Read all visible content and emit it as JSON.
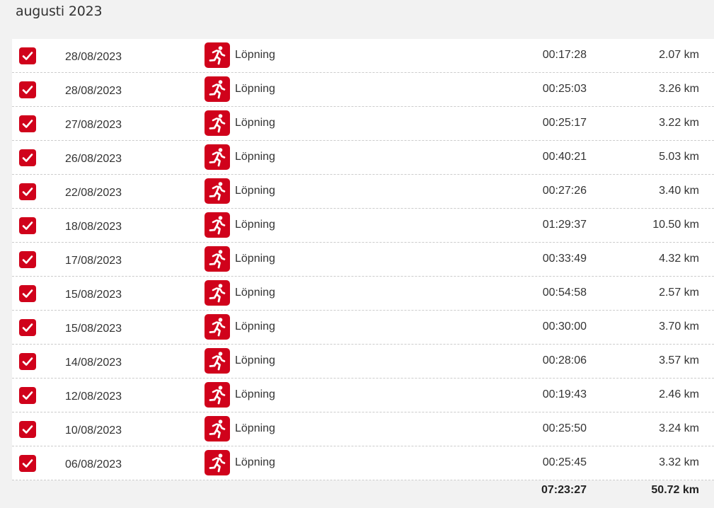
{
  "month_title": "augusti 2023",
  "colors": {
    "accent": "#d0021b",
    "background": "#f2f2f2",
    "row_background": "#ffffff",
    "divider": "#cccccc"
  },
  "rows": [
    {
      "checked": true,
      "date": "28/08/2023",
      "icon": "running-person-icon",
      "activity": "Löpning",
      "duration": "00:17:28",
      "distance": "2.07 km"
    },
    {
      "checked": true,
      "date": "28/08/2023",
      "icon": "running-person-icon",
      "activity": "Löpning",
      "duration": "00:25:03",
      "distance": "3.26 km"
    },
    {
      "checked": true,
      "date": "27/08/2023",
      "icon": "running-person-icon",
      "activity": "Löpning",
      "duration": "00:25:17",
      "distance": "3.22 km"
    },
    {
      "checked": true,
      "date": "26/08/2023",
      "icon": "running-person-icon",
      "activity": "Löpning",
      "duration": "00:40:21",
      "distance": "5.03 km"
    },
    {
      "checked": true,
      "date": "22/08/2023",
      "icon": "running-person-icon",
      "activity": "Löpning",
      "duration": "00:27:26",
      "distance": "3.40 km"
    },
    {
      "checked": true,
      "date": "18/08/2023",
      "icon": "running-person-icon",
      "activity": "Löpning",
      "duration": "01:29:37",
      "distance": "10.50 km"
    },
    {
      "checked": true,
      "date": "17/08/2023",
      "icon": "running-person-icon",
      "activity": "Löpning",
      "duration": "00:33:49",
      "distance": "4.32 km"
    },
    {
      "checked": true,
      "date": "15/08/2023",
      "icon": "running-person-icon",
      "activity": "Löpning",
      "duration": "00:54:58",
      "distance": "2.57 km"
    },
    {
      "checked": true,
      "date": "15/08/2023",
      "icon": "running-person-icon",
      "activity": "Löpning",
      "duration": "00:30:00",
      "distance": "3.70 km"
    },
    {
      "checked": true,
      "date": "14/08/2023",
      "icon": "running-person-icon",
      "activity": "Löpning",
      "duration": "00:28:06",
      "distance": "3.57 km"
    },
    {
      "checked": true,
      "date": "12/08/2023",
      "icon": "running-person-icon",
      "activity": "Löpning",
      "duration": "00:19:43",
      "distance": "2.46 km"
    },
    {
      "checked": true,
      "date": "10/08/2023",
      "icon": "running-person-icon",
      "activity": "Löpning",
      "duration": "00:25:50",
      "distance": "3.24 km"
    },
    {
      "checked": true,
      "date": "06/08/2023",
      "icon": "running-person-icon",
      "activity": "Löpning",
      "duration": "00:25:45",
      "distance": "3.32 km"
    }
  ],
  "totals": {
    "duration": "07:23:27",
    "distance": "50.72 km"
  }
}
